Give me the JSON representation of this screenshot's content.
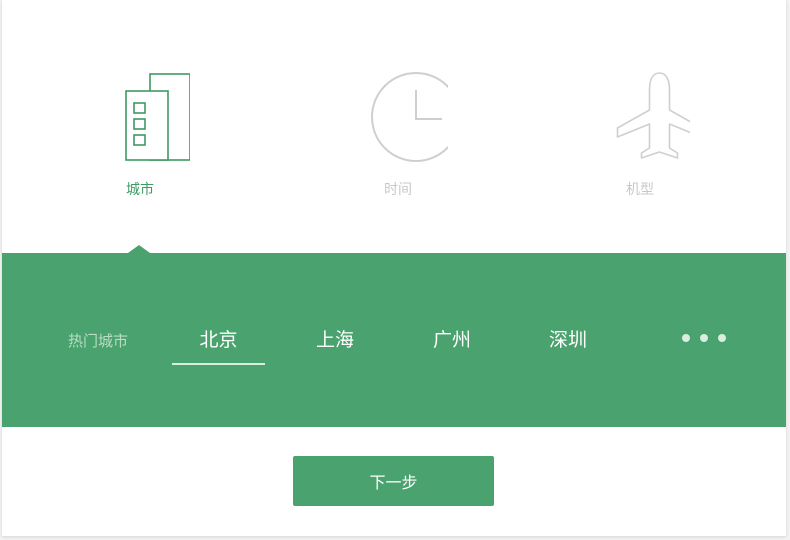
{
  "colors": {
    "accent": "#4aa36e",
    "active_icon": "#3d9a63",
    "inactive": "#c8c8c8"
  },
  "tabs": [
    {
      "label": "城市",
      "icon": "building-icon",
      "active": true
    },
    {
      "label": "时间",
      "icon": "clock-icon",
      "active": false
    },
    {
      "label": "机型",
      "icon": "airplane-icon",
      "active": false
    }
  ],
  "city_panel": {
    "hot_label": "热门城市",
    "cities": [
      "北京",
      "上海",
      "广州",
      "深圳"
    ],
    "selected_city": "北京",
    "more_icon": "more-dots-icon"
  },
  "next_button": {
    "label": "下一步"
  }
}
